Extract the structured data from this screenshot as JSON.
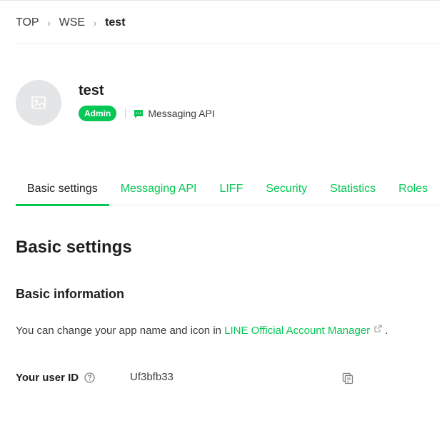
{
  "breadcrumb": {
    "items": [
      "TOP",
      "WSE",
      "test"
    ]
  },
  "channel": {
    "name": "test",
    "role_badge": "Admin",
    "type": "Messaging API"
  },
  "tabs": [
    {
      "label": "Basic settings",
      "active": true
    },
    {
      "label": "Messaging API",
      "active": false
    },
    {
      "label": "LIFF",
      "active": false
    },
    {
      "label": "Security",
      "active": false
    },
    {
      "label": "Statistics",
      "active": false
    },
    {
      "label": "Roles",
      "active": false
    }
  ],
  "main": {
    "section_title": "Basic settings",
    "subsection_title": "Basic information",
    "info_prefix": "You can change your app name and icon in ",
    "info_link": "LINE Official Account Manager",
    "info_suffix": ".",
    "user_id_label": "Your user ID",
    "user_id_value": "Uf3bfb33"
  },
  "icons": {
    "avatar": "image-placeholder-icon",
    "channel_type": "chat-bubble-icon",
    "link": "external-link-icon",
    "help": "help-circle-icon",
    "copy": "copy-icon"
  },
  "colors": {
    "accent": "#06c755",
    "text": "#1e1e1e",
    "avatar_bg": "#e4e5e7"
  }
}
